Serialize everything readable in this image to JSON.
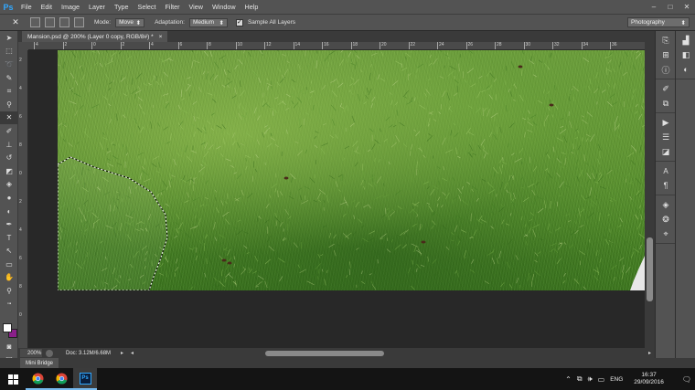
{
  "app": {
    "logo": "Ps",
    "accent": "#31a8ff"
  },
  "menu": [
    "File",
    "Edit",
    "Image",
    "Layer",
    "Type",
    "Select",
    "Filter",
    "View",
    "Window",
    "Help"
  ],
  "window_controls": {
    "minimize": "–",
    "maximize": "□",
    "close": "✕"
  },
  "options": {
    "mode_label": "Mode:",
    "mode_value": "Move",
    "adaptation_label": "Adaptation:",
    "adaptation_value": "Medium",
    "sample_all_layers_label": "Sample All Layers",
    "sample_all_layers_checked": true,
    "workspace": "Photography"
  },
  "document": {
    "tab_title": "Mansion.psd @ 200% (Layer 0 copy, RGB/8#) *",
    "close_glyph": "×"
  },
  "ruler_top_labels": [
    "4",
    "2",
    "0",
    "2",
    "4",
    "6",
    "8",
    "10",
    "12",
    "14",
    "16",
    "18",
    "20",
    "22",
    "24",
    "26",
    "28",
    "30",
    "32",
    "34",
    "36"
  ],
  "ruler_left_labels": [
    "2",
    "4",
    "6",
    "8",
    "0",
    "2",
    "4",
    "6",
    "8",
    "0"
  ],
  "status": {
    "zoom": "200%",
    "doc_size": "Doc: 3.12M/6.68M",
    "arrow_right": "▸",
    "arrow_left": "◂"
  },
  "colors": {
    "foreground": "#ffffff",
    "background": "#8a1f8a"
  },
  "mini_bridge": "Mini Bridge",
  "taskbar": {
    "apps": [
      "chrome-icon",
      "chrome-icon",
      "photoshop-icon"
    ],
    "photoshop_label": "Ps",
    "language": "ENG",
    "time": "16:37",
    "date": "29/09/2016"
  }
}
